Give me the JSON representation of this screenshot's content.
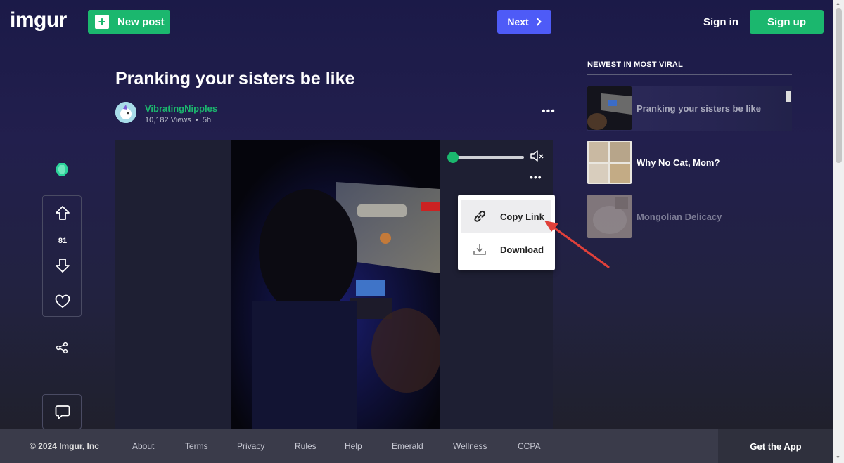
{
  "header": {
    "logo": "imgur",
    "new_post_label": "New post",
    "next_label": "Next",
    "sign_in_label": "Sign in",
    "sign_up_label": "Sign up"
  },
  "post": {
    "title": "Pranking your sisters be like",
    "author": "VibratingNipples",
    "views": "10,182 Views",
    "separator": "•",
    "age": "5h",
    "score": "81"
  },
  "media_menu": {
    "items": [
      {
        "label": "Copy Link",
        "icon": "link-icon"
      },
      {
        "label": "Download",
        "icon": "download-icon"
      }
    ]
  },
  "sidebar": {
    "heading": "NEWEST IN MOST VIRAL",
    "items": [
      {
        "title": "Pranking your sisters be like"
      },
      {
        "title": "Why No Cat, Mom?"
      },
      {
        "title": "Mongolian Delicacy"
      }
    ]
  },
  "footer": {
    "copyright": "© 2024 Imgur, Inc",
    "links": [
      "About",
      "Terms",
      "Privacy",
      "Rules",
      "Help",
      "Emerald",
      "Wellness",
      "CCPA"
    ],
    "get_app": "Get the App"
  },
  "colors": {
    "accent_green": "#1bb76e",
    "next_blue": "#4e5bf7",
    "annotation_arrow": "#e0403a"
  }
}
